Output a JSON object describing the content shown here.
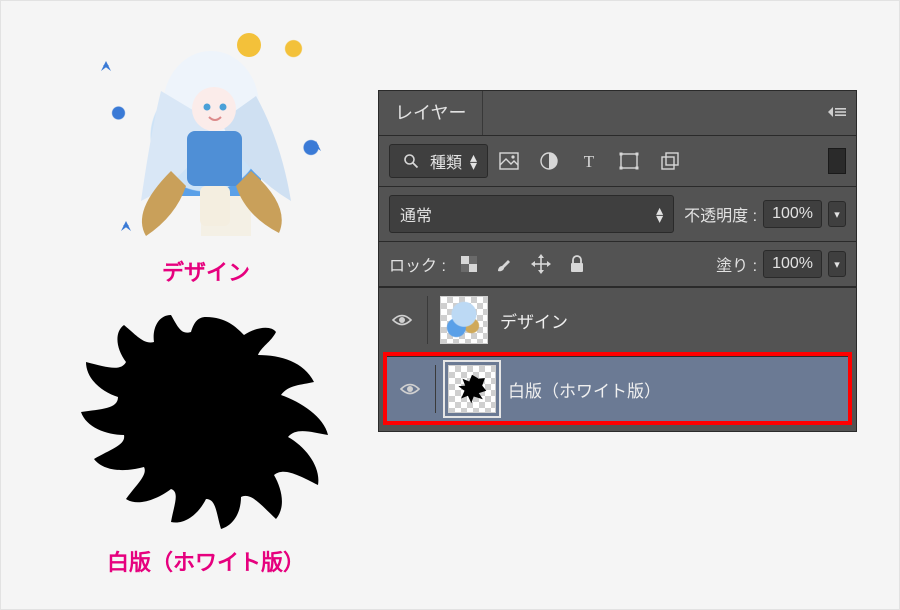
{
  "leftSide": {
    "designLabel": "デザイン",
    "silhouetteLabel": "白版（ホワイト版）"
  },
  "panel": {
    "title": "レイヤー",
    "filter": {
      "searchIcon": "search-icon",
      "typeLabel": "種類",
      "icons": [
        "image-icon",
        "adjustment-icon",
        "type-icon",
        "shape-icon",
        "smartobject-icon"
      ]
    },
    "blend": {
      "mode": "通常",
      "opacityLabel": "不透明度 :",
      "opacityValue": "100%"
    },
    "lock": {
      "label": "ロック :",
      "icons": [
        "transparency-lock-icon",
        "brush-lock-icon",
        "move-lock-icon",
        "full-lock-icon"
      ],
      "fillLabel": "塗り :",
      "fillValue": "100%"
    },
    "layers": [
      {
        "name": "デザイン",
        "visible": true,
        "selected": false,
        "thumb": "design"
      },
      {
        "name": "白版（ホワイト版）",
        "visible": true,
        "selected": true,
        "thumb": "sil",
        "highlighted": true
      }
    ]
  }
}
